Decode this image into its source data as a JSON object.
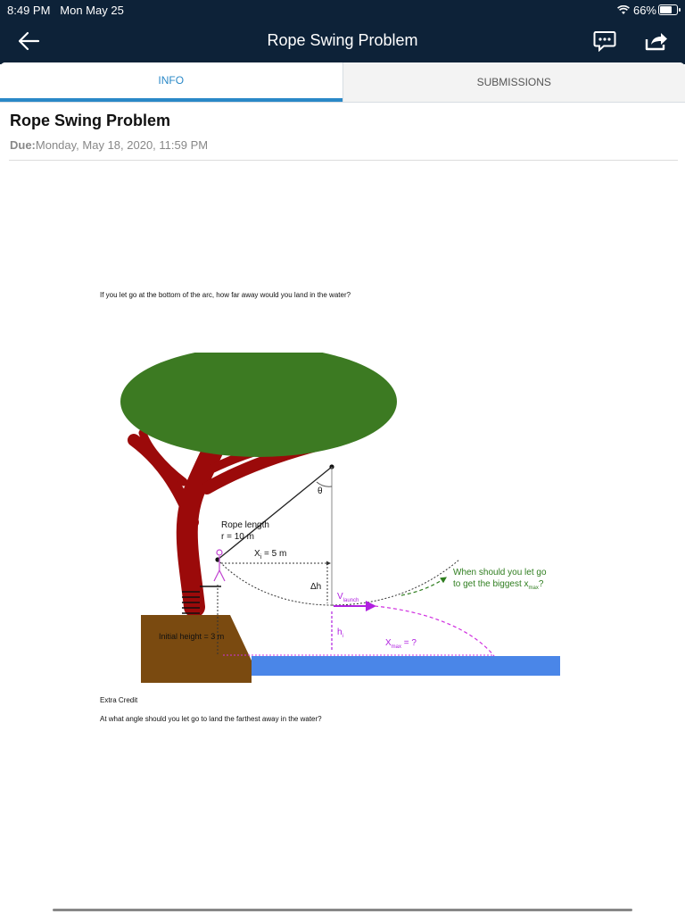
{
  "status": {
    "time": "8:49 PM",
    "date": "Mon May 25",
    "battery": "66%"
  },
  "nav": {
    "title": "Rope Swing Problem"
  },
  "tabs": [
    {
      "label": "INFO"
    },
    {
      "label": "SUBMISSIONS"
    }
  ],
  "assignment": {
    "title": "Rope Swing Problem",
    "due_label": "Due:",
    "due_date": "Monday, May 18, 2020, 11:59 PM",
    "question": "If you let go at the bottom of the arc, how far away would you land in the water?",
    "extra_credit": "Extra Credit",
    "extra_question": "At what angle should you let go to land the farthest away in the water?"
  },
  "diagram": {
    "theta": "θ",
    "rope_length_label": "Rope length",
    "rope_length_value": "r = 10 m",
    "xi_prefix": "X",
    "xi_sub": "i",
    "xi_value": " = 5 m",
    "dh": "Δh",
    "v": "V",
    "v_sub": "launch",
    "hi": "h",
    "hi_sub": "i",
    "initial_height": "Initial height = 3 m",
    "xmax_prefix": "X",
    "xmax_sub": "max",
    "xmax_value": " = ?",
    "callout_line1": "When should you let go",
    "callout_line2_prefix": "to get the biggest x",
    "callout_line2_sub": "max",
    "callout_line2_suffix": "?",
    "colors": {
      "canopy": "#3c7a22",
      "trunk": "#9b0a0a",
      "ground": "#7a4a10",
      "water": "#4a86e8",
      "purple": "#b020e0",
      "green": "#2e7d1e"
    }
  }
}
